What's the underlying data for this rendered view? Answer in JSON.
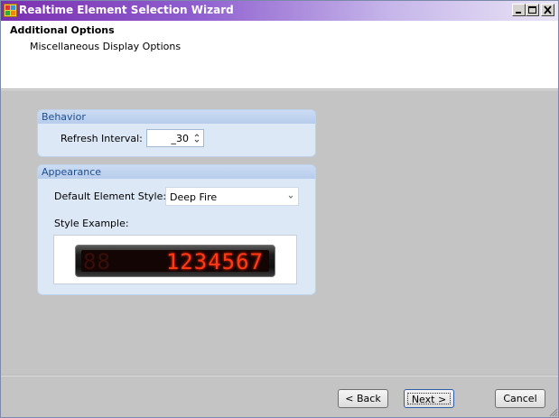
{
  "window": {
    "title": "Realtime Element Selection Wizard",
    "controls": {
      "minimize_icon": "minimize-icon",
      "maximize_icon": "maximize-icon",
      "close_icon": "close-icon"
    }
  },
  "header": {
    "title": "Additional Options",
    "subtitle": "Miscellaneous Display Options"
  },
  "behavior": {
    "heading": "Behavior",
    "refresh_label": "Refresh Interval:",
    "refresh_value": "_30"
  },
  "appearance": {
    "heading": "Appearance",
    "style_label": "Default Element Style:",
    "style_value": "Deep Fire",
    "example_label": "Style Example:",
    "example_digits": "1234567",
    "example_ghost": "88"
  },
  "buttons": {
    "back": "< Back",
    "next": "Next >",
    "cancel": "Cancel"
  },
  "colors": {
    "title_bar_start": "#7b2fb0",
    "panel_heading": "#1e4f8c",
    "led_segment": "#ff3a14"
  }
}
